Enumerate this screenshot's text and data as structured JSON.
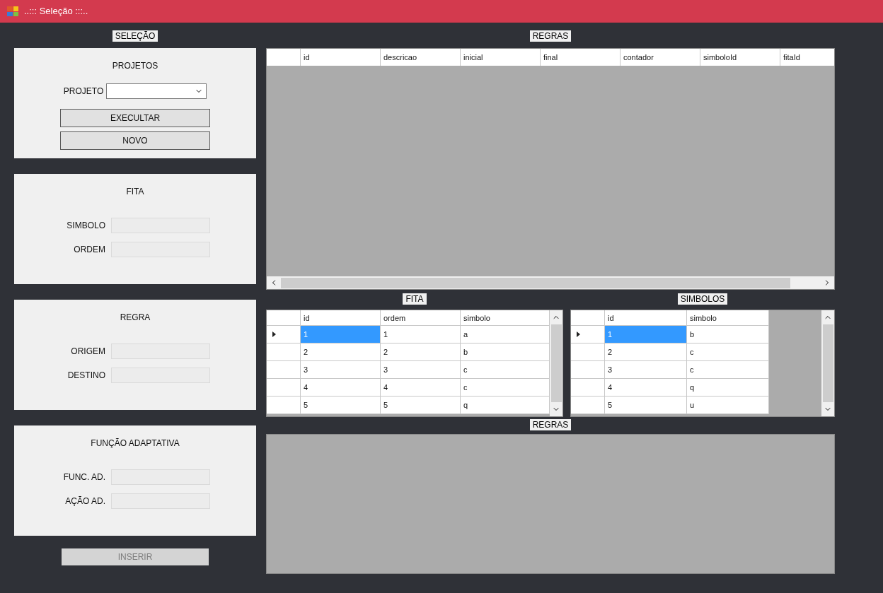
{
  "window": {
    "title": "..::: Seleção :::.."
  },
  "left": {
    "heading": "SELEÇÃO",
    "panels": [
      {
        "kind": "project",
        "title": "PROJETOS",
        "select_label": "PROJETO",
        "buttons": [
          {
            "label": "EXECULTAR",
            "disabled": false
          },
          {
            "label": "NOVO",
            "disabled": false
          }
        ]
      },
      {
        "kind": "fields",
        "title": "FITA",
        "fields": [
          {
            "label": "SIMBOLO",
            "disabled": true
          },
          {
            "label": "ORDEM",
            "disabled": true
          }
        ]
      },
      {
        "kind": "fields",
        "title": "REGRA",
        "fields": [
          {
            "label": "ORIGEM",
            "disabled": true
          },
          {
            "label": "DESTINO",
            "disabled": true
          }
        ]
      },
      {
        "kind": "fields",
        "title": "FUNÇÃO ADAPTATIVA",
        "fields": [
          {
            "label": "FUNC. AD.",
            "disabled": true
          },
          {
            "label": "AÇÃO AD.",
            "disabled": true
          }
        ]
      }
    ],
    "insert_button": {
      "label": "INSERIR",
      "disabled": true
    }
  },
  "rules_grid": {
    "heading": "REGRAS",
    "columns": [
      "id",
      "descricao",
      "inicial",
      "final",
      "contador",
      "simboloId",
      "fitaId"
    ]
  },
  "fita_grid": {
    "heading": "FITA",
    "columns": [
      "id",
      "ordem",
      "simbolo"
    ],
    "rows": [
      {
        "selected": true,
        "cells": [
          "1",
          "1",
          "a"
        ]
      },
      {
        "selected": false,
        "cells": [
          "2",
          "2",
          "b"
        ]
      },
      {
        "selected": false,
        "cells": [
          "3",
          "3",
          "c"
        ]
      },
      {
        "selected": false,
        "cells": [
          "4",
          "4",
          "c"
        ]
      },
      {
        "selected": false,
        "cells": [
          "5",
          "5",
          "q"
        ]
      }
    ]
  },
  "simbolos_grid": {
    "heading": "SIMBOLOS",
    "columns": [
      "id",
      "simbolo"
    ],
    "rows": [
      {
        "selected": true,
        "cells": [
          "1",
          "b"
        ]
      },
      {
        "selected": false,
        "cells": [
          "2",
          "c"
        ]
      },
      {
        "selected": false,
        "cells": [
          "3",
          "c"
        ]
      },
      {
        "selected": false,
        "cells": [
          "4",
          "q"
        ]
      },
      {
        "selected": false,
        "cells": [
          "5",
          "u"
        ]
      }
    ]
  },
  "rules_list": {
    "heading": "REGRAS"
  }
}
